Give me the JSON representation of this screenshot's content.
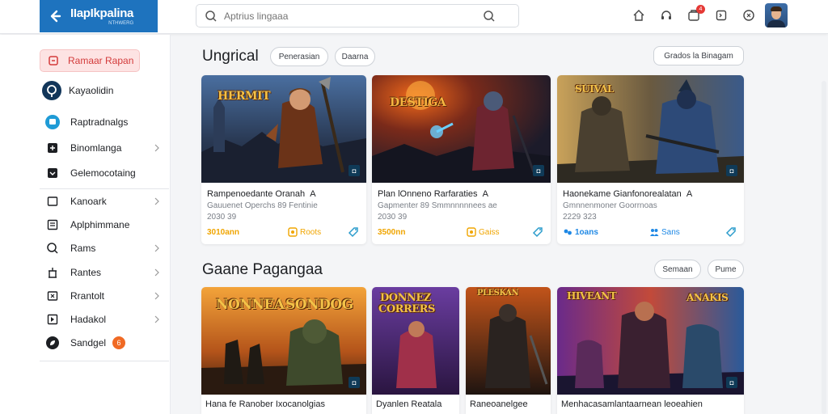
{
  "header": {
    "logo_title": "IIapIkpalina",
    "logo_sub": "NTHWERG",
    "search_placeholder": "Aptrius lingaaa",
    "notification_count": "4"
  },
  "sidebar": {
    "active_label": "Ramaar Rapan",
    "items": [
      {
        "label": "Kayaolidin"
      },
      {
        "label": "Raptradnalgs"
      },
      {
        "label": "Binomlanga"
      },
      {
        "label": "Gelemocotaing"
      },
      {
        "label": "Kanoark"
      },
      {
        "label": "Aplphimmane"
      },
      {
        "label": "Rams"
      },
      {
        "label": "Rantes"
      },
      {
        "label": "Rrantolt"
      },
      {
        "label": "Hadakol"
      },
      {
        "label": "Sandgel"
      }
    ],
    "sandgel_badge": "6"
  },
  "section1": {
    "title": "Ungrical",
    "filter1": "Penerasian",
    "filter2": "Daarna",
    "action": "Grados la Binagam",
    "cards": [
      {
        "art_title": "HERMIT",
        "title": "Rampenoedante Oranah",
        "title_suffix": "A",
        "desc": "Gauuenet Operchs 89 Fentinie",
        "date": "2030 39",
        "price": "3010ann",
        "rating": "Roots"
      },
      {
        "art_title": "DESTIGA",
        "title": "Plan lOnneno Rarfaraties",
        "title_suffix": "A",
        "desc": "Gapmenter 89 Smmnnnnnees ae",
        "date": "2030 39",
        "price": "3500nn",
        "rating": "Gaiss"
      },
      {
        "art_title": "SUIVAL",
        "title": "Haonekame Gianfonorealatan",
        "title_suffix": "A",
        "desc": "Gmnnenmoner Goorrnoas",
        "date": "2229 323",
        "price": "1oans",
        "rating": "Sans"
      }
    ]
  },
  "section2": {
    "title": "Gaane Pagangaa",
    "filter1": "Semaan",
    "filter2": "Pume",
    "cards": [
      {
        "art_title_a": "NONNEA",
        "art_title_b": "SONDOG",
        "title": "Hana fe Ranober Ixocanolgias"
      },
      {
        "art_title_a": "DONNEZ",
        "art_title_b": "CORRERS",
        "title": "Dyanlen Reatala"
      },
      {
        "art_title": "PLESKAN",
        "title": "Raneoanelgee"
      },
      {
        "art_title_a": "HIVEANT",
        "art_title_b": "ANAKIS",
        "title": "Menhacasamlantaarnean leoeahien"
      }
    ]
  },
  "colors": {
    "brand_blue": "#1e73be",
    "active_red": "#d33b3b",
    "price_gold": "#f0a500",
    "rating_blue": "#1e88e5",
    "badge_orange": "#f06a24"
  }
}
